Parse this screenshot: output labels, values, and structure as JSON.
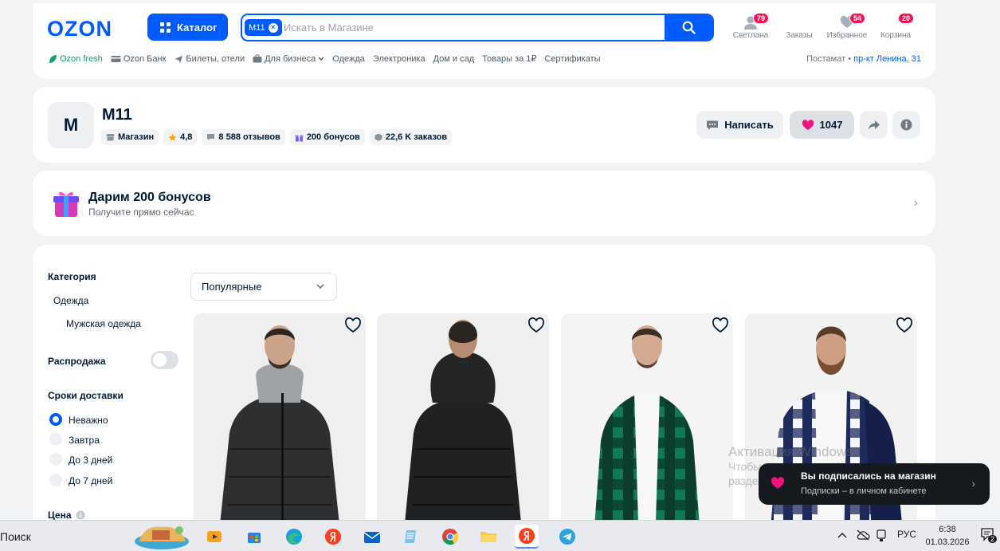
{
  "header": {
    "logo": "OZON",
    "catalog_label": "Каталог",
    "search_chip": "М11",
    "search_chip_close": "×",
    "search_placeholder": "Искать в Магазине",
    "user": {
      "label": "Светлана",
      "badge": "79"
    },
    "orders": {
      "label": "Заказы"
    },
    "favorites": {
      "label": "Избранное",
      "badge": "54"
    },
    "cart": {
      "label": "Корзина",
      "badge": "20"
    },
    "nav": [
      "Ozon fresh",
      "Ozon Банк",
      "Билеты, отели",
      "Для бизнеса",
      "Одежда",
      "Электроника",
      "Дом и сад",
      "Товары за 1₽",
      "Сертификаты"
    ],
    "address_label": "Постамат",
    "address_sep": "•",
    "address_value": "пр-кт Ленина, 31"
  },
  "shop": {
    "avatar_letter": "M",
    "name": "М11",
    "stats": {
      "type": "Магазин",
      "rating": "4,8",
      "reviews": "8 588 отзывов",
      "bonus": "200 бонусов",
      "orders": "22,6 K заказов"
    },
    "write_label": "Написать",
    "likes": "1047"
  },
  "bonus_banner": {
    "title": "Дарим 200 бонусов",
    "subtitle": "Получите прямо сейчас",
    "chevron": "›"
  },
  "filters": {
    "category_title": "Категория",
    "category": "Одежда",
    "subcategory": "Мужская одежда",
    "sale_label": "Распродажа",
    "delivery_title": "Сроки доставки",
    "delivery_options": [
      "Неважно",
      "Завтра",
      "До 3 дней",
      "До 7 дней"
    ],
    "price_title": "Цена"
  },
  "sort": {
    "selected": "Популярные"
  },
  "watermark": {
    "line1": "Активация Windows",
    "line2": "Чтобы активировать Windows, перейдите в",
    "line3": "раздел \"Параметры\"."
  },
  "toast": {
    "title": "Вы подписались на магазин",
    "text": "Подписки – в личном кабинете",
    "chevron": "›"
  },
  "taskbar": {
    "search": "Поиск",
    "lang": "РУС",
    "time": "6:38",
    "date": "01.03.2026",
    "notifications": "2"
  },
  "colors": {
    "accent": "#005bff",
    "badge": "#f91155",
    "fresh": "#10a064"
  }
}
